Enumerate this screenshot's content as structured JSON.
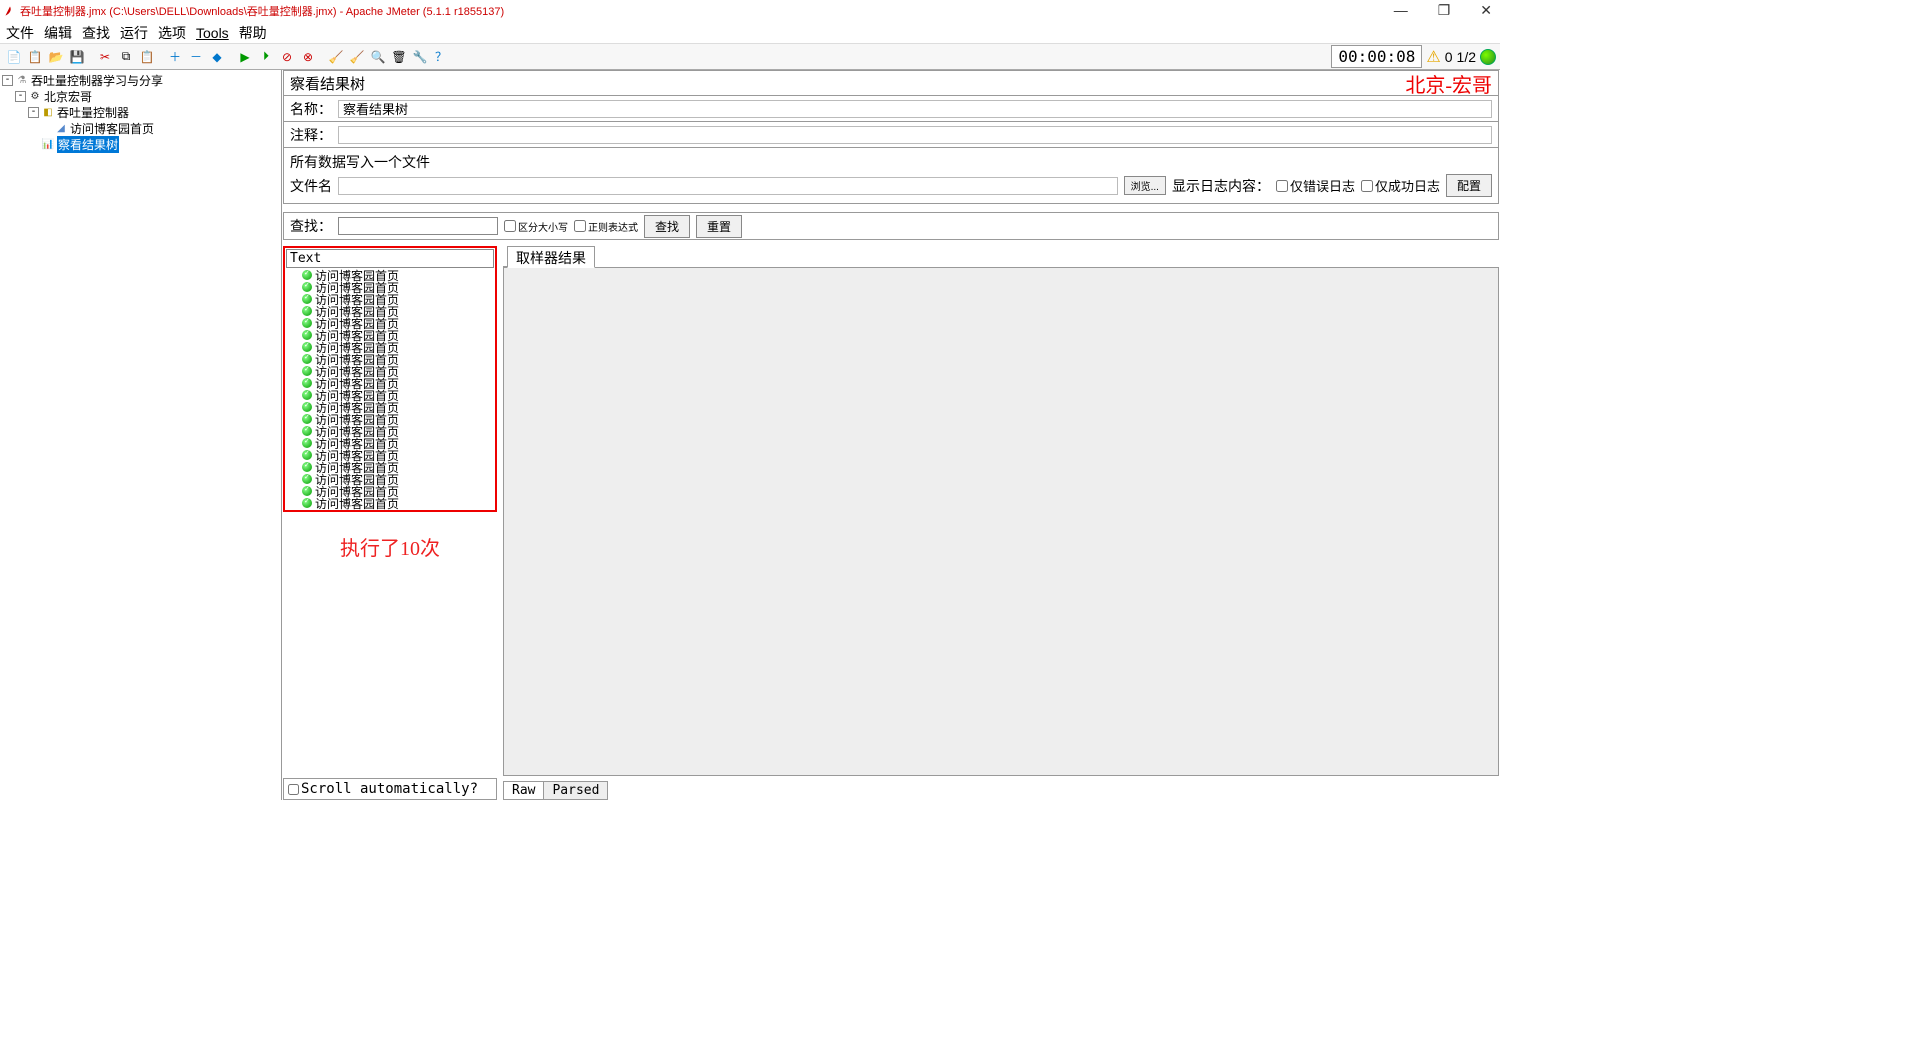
{
  "title": "吞吐量控制器.jmx (C:\\Users\\DELL\\Downloads\\吞吐量控制器.jmx) - Apache JMeter (5.1.1 r1855137)",
  "menu": {
    "file": "文件",
    "edit": "编辑",
    "search": "查找",
    "run": "运行",
    "options": "选项",
    "tools": "Tools",
    "help": "帮助"
  },
  "timer": "00:00:08",
  "warn_count": "0",
  "thread_count": "1/2",
  "tree": {
    "root": "吞吐量控制器学习与分享",
    "n1": "北京宏哥",
    "n2": "吞吐量控制器",
    "n3": "访问博客园首页",
    "n4": "察看结果树"
  },
  "panel": {
    "title": "察看结果树",
    "watermark": "北京-宏哥",
    "name_label": "名称：",
    "name_value": "察看结果树",
    "comment_label": "注释：",
    "file_section": "所有数据写入一个文件",
    "filename_label": "文件名",
    "browse": "浏览...",
    "show_log": "显示日志内容：",
    "only_error": "仅错误日志",
    "only_success": "仅成功日志",
    "configure": "配置"
  },
  "search": {
    "label": "查找：",
    "case": "区分大小写",
    "regex": "正则表达式",
    "find": "查找",
    "reset": "重置"
  },
  "results": {
    "dropdown": "Text",
    "sampler_tab": "取样器结果",
    "items": [
      "访问博客园首页",
      "访问博客园首页",
      "访问博客园首页",
      "访问博客园首页",
      "访问博客园首页",
      "访问博客园首页",
      "访问博客园首页",
      "访问博客园首页",
      "访问博客园首页",
      "访问博客园首页",
      "访问博客园首页",
      "访问博客园首页",
      "访问博客园首页",
      "访问博客园首页",
      "访问博客园首页",
      "访问博客园首页",
      "访问博客园首页",
      "访问博客园首页",
      "访问博客园首页",
      "访问博客园首页"
    ],
    "annotation": "执行了10次",
    "scroll_auto": "Scroll automatically?",
    "raw": "Raw",
    "parsed": "Parsed"
  }
}
